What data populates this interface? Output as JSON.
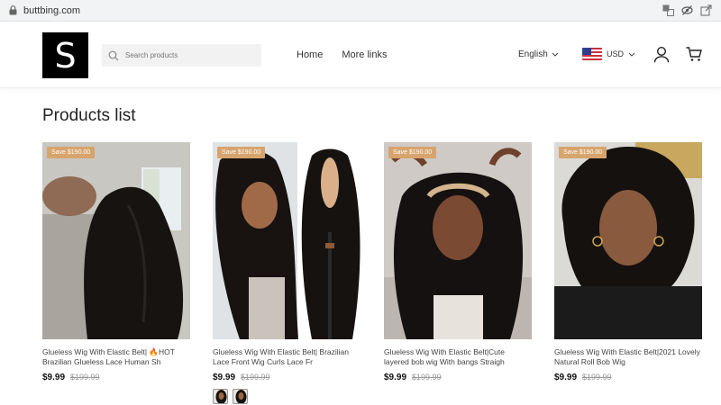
{
  "browser": {
    "url": "buttbing.com",
    "icons": [
      "translate-icon",
      "visibility-off-icon",
      "share-icon"
    ]
  },
  "header": {
    "logo_letter": "S",
    "search_placeholder": "Search products",
    "nav": [
      "Home",
      "More links"
    ],
    "language": "English",
    "currency": "USD",
    "icons": {
      "account": "user-icon",
      "cart": "cart-icon",
      "flag": "us-flag-icon"
    }
  },
  "main": {
    "title": "Products list",
    "products": [
      {
        "badge": "Save $190.00",
        "title": "Glueless Wig With Elastic Belt| 🔥HOT Brazilian Glueless Lace Human Sh",
        "price": "$9.99",
        "compare_price": "$199.99"
      },
      {
        "badge": "Save $190.00",
        "title": "Glueless Wig With Elastic Belt| Brazilian Lace Front Wig Curls Lace Fr",
        "price": "$9.99",
        "compare_price": "$199.99"
      },
      {
        "badge": "Save $190.00",
        "title": "Glueless Wig With Elastic Belt|Cute layered bob wig With bangs Straigh",
        "price": "$9.99",
        "compare_price": "$199.99"
      },
      {
        "badge": "Save $190.00",
        "title": "Glueless Wig With Elastic Belt|2021 Lovely Natural Roll Bob Wig",
        "price": "$9.99",
        "compare_price": "$199.99"
      }
    ]
  },
  "colors": {
    "badge": "#d7a46d",
    "logo_bg": "#000000"
  }
}
